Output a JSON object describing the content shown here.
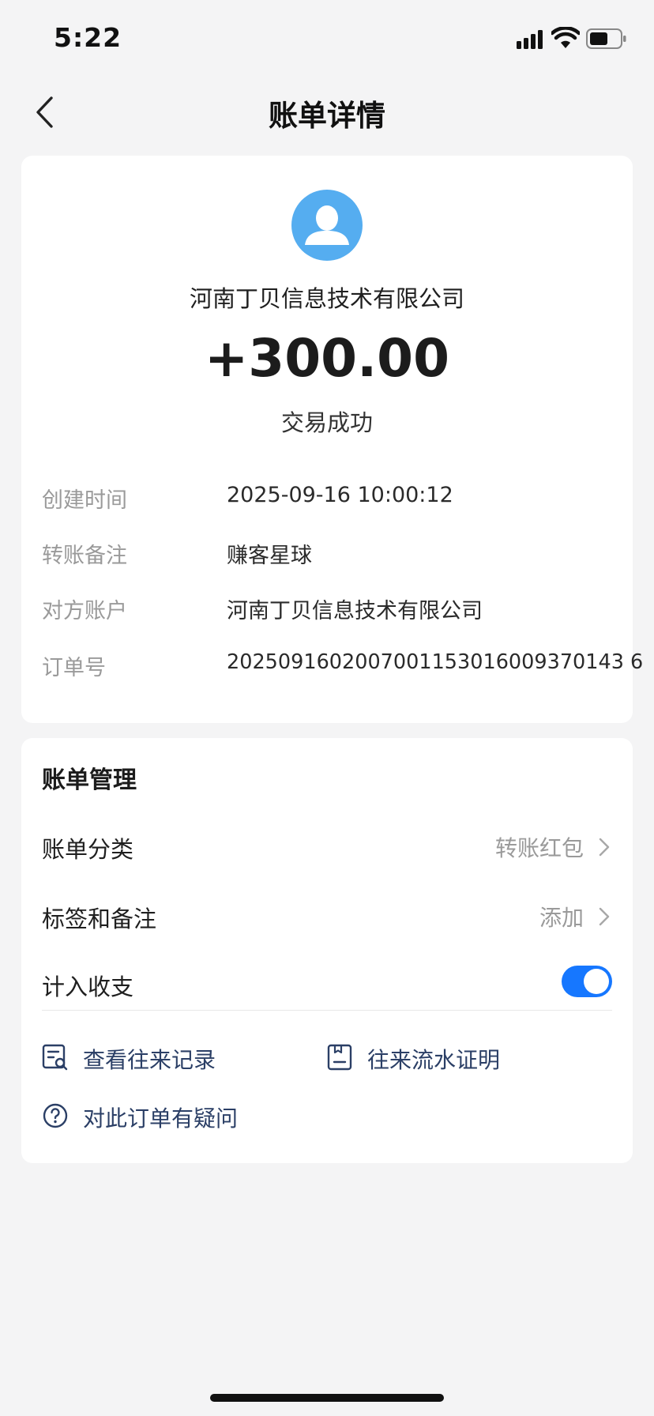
{
  "status_bar": {
    "time": "5:22"
  },
  "nav": {
    "title": "账单详情"
  },
  "summary": {
    "payee": "河南丁贝信息技术有限公司",
    "amount": "+300.00",
    "status": "交易成功",
    "details": [
      {
        "label": "创建时间",
        "value": "2025-09-16 10:00:12"
      },
      {
        "label": "转账备注",
        "value": "赚客星球"
      },
      {
        "label": "对方账户",
        "value": "河南丁贝信息技术有限公司"
      },
      {
        "label": "订单号",
        "value": "2025091602007001153016009370143 6"
      }
    ]
  },
  "manage": {
    "title": "账单管理",
    "category": {
      "label": "账单分类",
      "value": "转账红包"
    },
    "tags": {
      "label": "标签和备注",
      "value": "添加"
    },
    "budget": {
      "label": "计入收支",
      "enabled": true
    },
    "actions": {
      "history": "查看往来记录",
      "proof": "往来流水证明",
      "question": "对此订单有疑问"
    }
  },
  "colors": {
    "accent": "#1677ff",
    "avatar": "#55adf0",
    "link_text": "#2b3f66",
    "muted_text": "#9a9a9a"
  }
}
